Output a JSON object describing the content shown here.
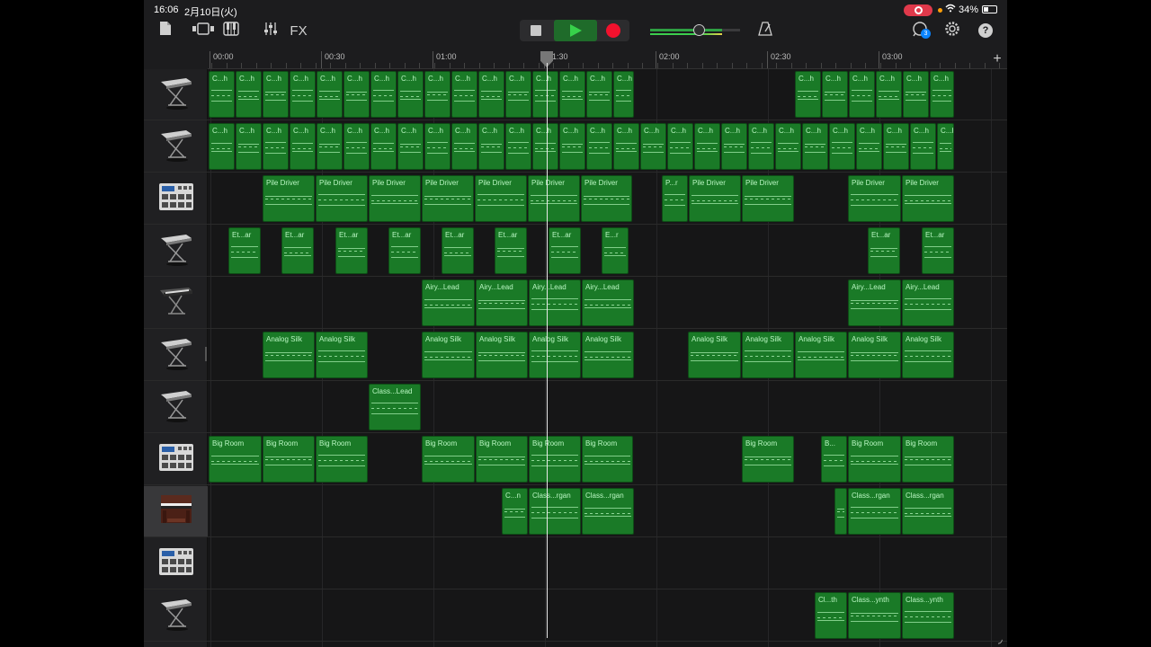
{
  "status_bar": {
    "time": "16:06",
    "date": "2月10日(火)",
    "battery": "34%"
  },
  "toolbar": {
    "fx_label": "FX",
    "notification_count": "3"
  },
  "ruler": {
    "labels": [
      "00:00",
      "00:30",
      "01:00",
      "01:30",
      "02:00",
      "02:30",
      "03:00"
    ]
  },
  "colors": {
    "region": "#1a7a27",
    "region_text": "#b9f6c2",
    "record": "#f2112d",
    "play": "#37d24a"
  },
  "tracks": [
    {
      "icon": "keyboard-stand-icon",
      "regions": [
        {
          "label": "C...h",
          "start": 0,
          "width": 30
        },
        {
          "label": "C...h",
          "start": 30,
          "width": 30
        },
        {
          "label": "C...h",
          "start": 60,
          "width": 30
        },
        {
          "label": "C...h",
          "start": 90,
          "width": 30
        },
        {
          "label": "C...h",
          "start": 120,
          "width": 30
        },
        {
          "label": "C...h",
          "start": 150,
          "width": 30
        },
        {
          "label": "C...h",
          "start": 180,
          "width": 30
        },
        {
          "label": "C...h",
          "start": 210,
          "width": 30
        },
        {
          "label": "C...h",
          "start": 240,
          "width": 30
        },
        {
          "label": "C...h",
          "start": 270,
          "width": 30
        },
        {
          "label": "C...h",
          "start": 300,
          "width": 30
        },
        {
          "label": "C...h",
          "start": 330,
          "width": 30
        },
        {
          "label": "C...h",
          "start": 360,
          "width": 30
        },
        {
          "label": "C...h",
          "start": 390,
          "width": 30
        },
        {
          "label": "C...h",
          "start": 420,
          "width": 30
        },
        {
          "label": "C...h",
          "start": 450,
          "width": 24
        },
        {
          "label": "C...h",
          "start": 652,
          "width": 30
        },
        {
          "label": "C...h",
          "start": 682,
          "width": 30
        },
        {
          "label": "C...h",
          "start": 712,
          "width": 30
        },
        {
          "label": "C...h",
          "start": 742,
          "width": 30
        },
        {
          "label": "C...h",
          "start": 772,
          "width": 30
        },
        {
          "label": "C...h",
          "start": 802,
          "width": 28
        }
      ]
    },
    {
      "icon": "keyboard-stand-icon",
      "regions": [
        {
          "label": "C...h",
          "start": 0,
          "width": 30
        },
        {
          "label": "C...h",
          "start": 30,
          "width": 30
        },
        {
          "label": "C...h",
          "start": 60,
          "width": 30
        },
        {
          "label": "C...h",
          "start": 90,
          "width": 30
        },
        {
          "label": "C...h",
          "start": 120,
          "width": 30
        },
        {
          "label": "C...h",
          "start": 150,
          "width": 30
        },
        {
          "label": "C...h",
          "start": 180,
          "width": 30
        },
        {
          "label": "C...h",
          "start": 210,
          "width": 30
        },
        {
          "label": "C...h",
          "start": 240,
          "width": 30
        },
        {
          "label": "C...h",
          "start": 270,
          "width": 30
        },
        {
          "label": "C...h",
          "start": 300,
          "width": 30
        },
        {
          "label": "C...h",
          "start": 330,
          "width": 30
        },
        {
          "label": "C...h",
          "start": 360,
          "width": 30
        },
        {
          "label": "C...h",
          "start": 390,
          "width": 30
        },
        {
          "label": "C...h",
          "start": 420,
          "width": 30
        },
        {
          "label": "C...h",
          "start": 450,
          "width": 30
        },
        {
          "label": "C...h",
          "start": 480,
          "width": 30
        },
        {
          "label": "C...h",
          "start": 510,
          "width": 30
        },
        {
          "label": "C...h",
          "start": 540,
          "width": 30
        },
        {
          "label": "C...h",
          "start": 570,
          "width": 30
        },
        {
          "label": "C...h",
          "start": 600,
          "width": 30
        },
        {
          "label": "C...h",
          "start": 630,
          "width": 30
        },
        {
          "label": "C...h",
          "start": 660,
          "width": 30
        },
        {
          "label": "C...h",
          "start": 690,
          "width": 30
        },
        {
          "label": "C...h",
          "start": 720,
          "width": 30
        },
        {
          "label": "C...h",
          "start": 750,
          "width": 30
        },
        {
          "label": "C...h",
          "start": 780,
          "width": 30
        },
        {
          "label": "C...h",
          "start": 810,
          "width": 20
        }
      ]
    },
    {
      "icon": "drum-machine-icon",
      "regions": [
        {
          "label": "Pile Driver",
          "start": 60,
          "width": 59
        },
        {
          "label": "Pile Driver",
          "start": 119,
          "width": 59
        },
        {
          "label": "Pile Driver",
          "start": 178,
          "width": 59
        },
        {
          "label": "Pile Driver",
          "start": 237,
          "width": 59
        },
        {
          "label": "Pile Driver",
          "start": 296,
          "width": 59
        },
        {
          "label": "Pile Driver",
          "start": 355,
          "width": 59
        },
        {
          "label": "Pile Driver",
          "start": 414,
          "width": 58
        },
        {
          "label": "P...r",
          "start": 504,
          "width": 30
        },
        {
          "label": "Pile Driver",
          "start": 534,
          "width": 59
        },
        {
          "label": "Pile Driver",
          "start": 593,
          "width": 59
        },
        {
          "label": "Pile Driver",
          "start": 711,
          "width": 60
        },
        {
          "label": "Pile Driver",
          "start": 771,
          "width": 59
        }
      ]
    },
    {
      "icon": "keyboard-stand-icon",
      "regions": [
        {
          "label": "Et...ar",
          "start": 22,
          "width": 37
        },
        {
          "label": "Et...ar",
          "start": 81,
          "width": 37
        },
        {
          "label": "Et...ar",
          "start": 141,
          "width": 37
        },
        {
          "label": "Et...ar",
          "start": 200,
          "width": 37
        },
        {
          "label": "Et...ar",
          "start": 259,
          "width": 37
        },
        {
          "label": "Et...ar",
          "start": 318,
          "width": 37
        },
        {
          "label": "Et...ar",
          "start": 378,
          "width": 37
        },
        {
          "label": "E...r",
          "start": 437,
          "width": 31
        },
        {
          "label": "Et...ar",
          "start": 733,
          "width": 37
        },
        {
          "label": "Et...ar",
          "start": 793,
          "width": 37
        }
      ]
    },
    {
      "icon": "synth-stand-icon",
      "regions": [
        {
          "label": "Airy...Lead",
          "start": 237,
          "width": 60
        },
        {
          "label": "Airy...Lead",
          "start": 297,
          "width": 59
        },
        {
          "label": "Airy...Lead",
          "start": 356,
          "width": 59
        },
        {
          "label": "Airy...Lead",
          "start": 415,
          "width": 59
        },
        {
          "label": "Airy...Lead",
          "start": 711,
          "width": 60
        },
        {
          "label": "Airy...Lead",
          "start": 771,
          "width": 59
        }
      ]
    },
    {
      "icon": "keyboard-stand-icon",
      "regions": [
        {
          "label": "Analog Silk",
          "start": 60,
          "width": 59
        },
        {
          "label": "Analog Silk",
          "start": 119,
          "width": 59
        },
        {
          "label": "Analog Silk",
          "start": 237,
          "width": 60
        },
        {
          "label": "Analog Silk",
          "start": 297,
          "width": 59
        },
        {
          "label": "Analog Silk",
          "start": 356,
          "width": 59
        },
        {
          "label": "Analog Silk",
          "start": 415,
          "width": 59
        },
        {
          "label": "Analog Silk",
          "start": 533,
          "width": 60
        },
        {
          "label": "Analog Silk",
          "start": 593,
          "width": 59
        },
        {
          "label": "Analog Silk",
          "start": 652,
          "width": 59
        },
        {
          "label": "Analog Silk",
          "start": 711,
          "width": 60
        },
        {
          "label": "Analog Silk",
          "start": 771,
          "width": 59
        }
      ]
    },
    {
      "icon": "keyboard-stand-icon",
      "regions": [
        {
          "label": "Class...Lead",
          "start": 178,
          "width": 59
        }
      ]
    },
    {
      "icon": "drum-machine-icon",
      "regions": [
        {
          "label": "Big Room",
          "start": 0,
          "width": 60
        },
        {
          "label": "Big Room",
          "start": 60,
          "width": 59
        },
        {
          "label": "Big Room",
          "start": 119,
          "width": 59
        },
        {
          "label": "Big Room",
          "start": 237,
          "width": 60
        },
        {
          "label": "Big Room",
          "start": 297,
          "width": 59
        },
        {
          "label": "Big Room",
          "start": 356,
          "width": 59
        },
        {
          "label": "Big Room",
          "start": 415,
          "width": 58
        },
        {
          "label": "Big Room",
          "start": 593,
          "width": 59
        },
        {
          "label": "B...",
          "start": 681,
          "width": 30
        },
        {
          "label": "Big Room",
          "start": 711,
          "width": 60
        },
        {
          "label": "Big Room",
          "start": 771,
          "width": 59
        }
      ]
    },
    {
      "icon": "organ-icon",
      "selected": true,
      "regions": [
        {
          "label": "C...n",
          "start": 326,
          "width": 30
        },
        {
          "label": "Class...rgan",
          "start": 356,
          "width": 59
        },
        {
          "label": "Class...rgan",
          "start": 415,
          "width": 59
        },
        {
          "label": "",
          "start": 696,
          "width": 15
        },
        {
          "label": "Class...rgan",
          "start": 711,
          "width": 60
        },
        {
          "label": "Class...rgan",
          "start": 771,
          "width": 59
        }
      ]
    },
    {
      "icon": "drum-machine-icon",
      "regions": []
    },
    {
      "icon": "keyboard-stand-icon",
      "regions": [
        {
          "label": "Cl...th",
          "start": 674,
          "width": 37
        },
        {
          "label": "Class...ynth",
          "start": 711,
          "width": 60
        },
        {
          "label": "Class...ynth",
          "start": 771,
          "width": 59
        }
      ]
    }
  ]
}
